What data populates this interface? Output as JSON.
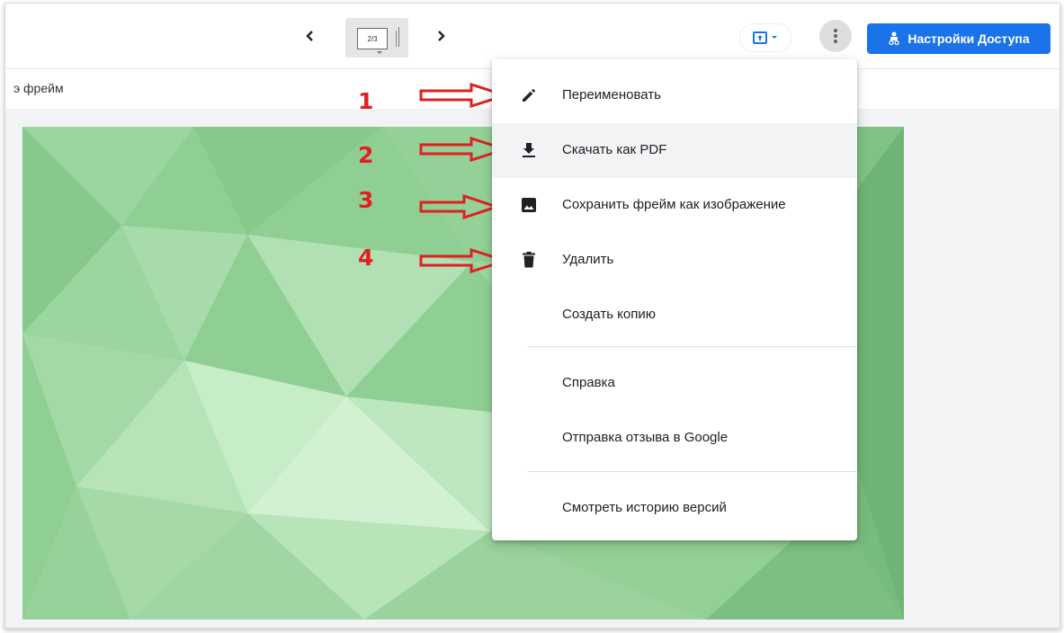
{
  "toolbar": {
    "page_indicator": "2/3",
    "share_label": "Настройки Доступа",
    "colors": {
      "accent": "#1a73e8"
    }
  },
  "subbar": {
    "frame_label": "э фрейм"
  },
  "menu": {
    "items": [
      {
        "label": "Переименовать",
        "icon": "pencil-icon"
      },
      {
        "label": "Скачать как PDF",
        "icon": "download-icon"
      },
      {
        "label": "Сохранить фрейм как изображение",
        "icon": "image-icon"
      },
      {
        "label": "Удалить",
        "icon": "trash-icon"
      },
      {
        "label": "Создать копию",
        "icon": ""
      },
      {
        "label": "Справка",
        "icon": ""
      },
      {
        "label": "Отправка отзыва в Google",
        "icon": ""
      },
      {
        "label": "Смотреть историю версий",
        "icon": ""
      }
    ]
  },
  "annotations": {
    "numbers": [
      "1",
      "2",
      "3",
      "4"
    ],
    "color": "#e02020"
  }
}
